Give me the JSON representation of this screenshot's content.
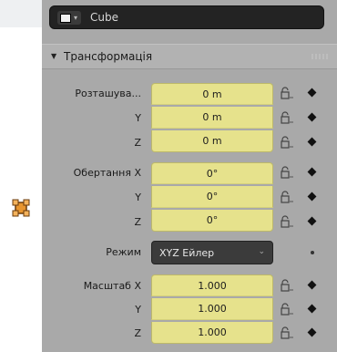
{
  "object": {
    "name": "Cube",
    "type_icon": "mesh-cube-icon"
  },
  "panel": {
    "section_title": "Трансформація"
  },
  "location": {
    "label": "Розташува...",
    "rows": [
      {
        "axis": "",
        "value": "0 m"
      },
      {
        "axis": "Y",
        "value": "0 m"
      },
      {
        "axis": "Z",
        "value": "0 m"
      }
    ]
  },
  "rotation": {
    "rows": [
      {
        "axis": "Обертання X",
        "value": "0°"
      },
      {
        "axis": "Y",
        "value": "0°"
      },
      {
        "axis": "Z",
        "value": "0°"
      }
    ]
  },
  "mode": {
    "label": "Режим",
    "value": "XYZ Ейлер"
  },
  "scale": {
    "rows": [
      {
        "axis": "Масштаб X",
        "value": "1.000"
      },
      {
        "axis": "Y",
        "value": "1.000"
      },
      {
        "axis": "Z",
        "value": "1.000"
      }
    ]
  },
  "colors": {
    "field_bg": "#e6e28c",
    "panel_bg": "#a9a9a9",
    "name_bg": "#232323",
    "accent_icon": "#e8952e"
  }
}
